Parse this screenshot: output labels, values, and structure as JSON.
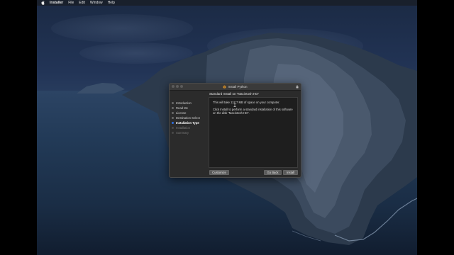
{
  "menubar": {
    "app": "Installer",
    "items": [
      "File",
      "Edit",
      "Window",
      "Help"
    ]
  },
  "window": {
    "title": "Install Python",
    "heading": "Standard Install on “Macintosh HD”",
    "steps": [
      {
        "label": "Introduction",
        "state": "done"
      },
      {
        "label": "Read Me",
        "state": "done"
      },
      {
        "label": "License",
        "state": "done"
      },
      {
        "label": "Destination Select",
        "state": "done"
      },
      {
        "label": "Installation Type",
        "state": "current"
      },
      {
        "label": "Installation",
        "state": "future"
      },
      {
        "label": "Summary",
        "state": "future"
      }
    ],
    "content": {
      "line1": "This will take 117.7 MB of space on your computer.",
      "line2": "Click Install to perform a standard installation of this software on the disk “Macintosh HD”."
    },
    "buttons": {
      "customize": "Customize",
      "go_back": "Go Back",
      "install": "Install"
    }
  },
  "colors": {
    "accent": "#2f6fe0",
    "window_bg": "#2b2b2b"
  }
}
